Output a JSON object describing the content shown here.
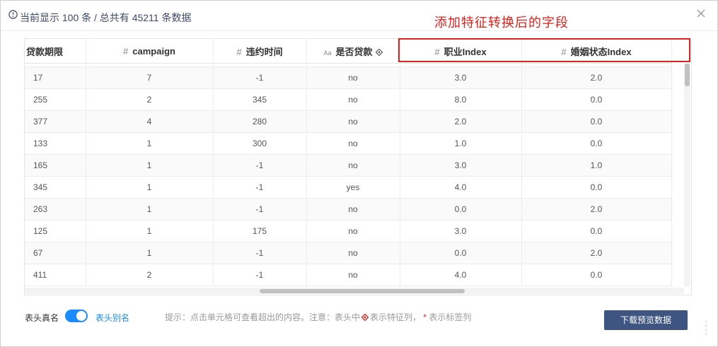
{
  "header": {
    "info_text": "当前显示 100 条 / 总共有 45211 条数据"
  },
  "annotation": "添加特征转换后的字段",
  "table": {
    "columns": [
      {
        "label": "贷款期限",
        "type": ""
      },
      {
        "label": "campaign",
        "type": "#"
      },
      {
        "label": "违约时间",
        "type": "#"
      },
      {
        "label": "是否贷款",
        "type": "Aa"
      },
      {
        "label": "职业Index",
        "type": "#"
      },
      {
        "label": "婚姻状态Index",
        "type": "#"
      }
    ],
    "rows": [
      [
        "17",
        "7",
        "-1",
        "no",
        "3.0",
        "2.0"
      ],
      [
        "255",
        "2",
        "345",
        "no",
        "8.0",
        "0.0"
      ],
      [
        "377",
        "4",
        "280",
        "no",
        "2.0",
        "0.0"
      ],
      [
        "133",
        "1",
        "300",
        "no",
        "1.0",
        "0.0"
      ],
      [
        "165",
        "1",
        "-1",
        "no",
        "3.0",
        "1.0"
      ],
      [
        "345",
        "1",
        "-1",
        "yes",
        "4.0",
        "0.0"
      ],
      [
        "263",
        "1",
        "-1",
        "no",
        "0.0",
        "2.0"
      ],
      [
        "125",
        "1",
        "175",
        "no",
        "3.0",
        "0.0"
      ],
      [
        "67",
        "1",
        "-1",
        "no",
        "0.0",
        "2.0"
      ],
      [
        "411",
        "2",
        "-1",
        "no",
        "4.0",
        "0.0"
      ]
    ]
  },
  "footer": {
    "real_name_label": "表头真名",
    "alias_label": "表头别名",
    "toggle_on": true,
    "hint_prefix": "提示：点击单元格可查看超出的内容。注意：表头中",
    "hint_feature": "表示特征列，",
    "hint_star": "*",
    "hint_label": "表示标签列",
    "download_label": "下载预览数据"
  },
  "colors": {
    "accent": "#1a8cff",
    "annotation_red": "#e0201a",
    "button_bg": "#3d5580"
  }
}
